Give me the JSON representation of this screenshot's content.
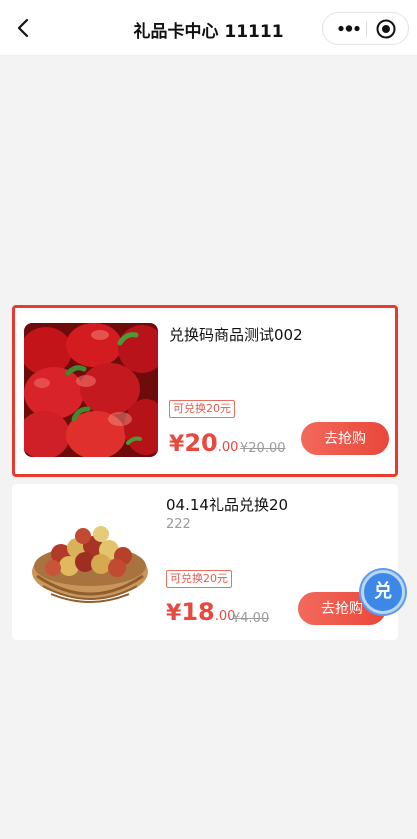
{
  "nav": {
    "title": "礼品卡中心 11111",
    "back_icon": "chevron-left-icon",
    "more_icon": "more-dots-icon",
    "close_icon": "target-circle-icon"
  },
  "products": [
    {
      "name": "兑换码商品测试002",
      "subtitle": "",
      "tag": "可兑换20元",
      "currency": "¥",
      "price_int": "20",
      "price_dec": ".00",
      "original_price": "¥20.00",
      "button_label": "去抢购",
      "image": "red-bell-peppers-image"
    },
    {
      "name": "04.14礼品兑换20",
      "subtitle": "222",
      "tag": "可兑换20元",
      "currency": "¥",
      "price_int": "18",
      "price_dec": ".00",
      "original_price": "¥4.00",
      "button_label": "去抢购",
      "image": "jujube-basket-image"
    }
  ],
  "float_button": {
    "label": "兑"
  },
  "colors": {
    "accent_red": "#e8483f",
    "highlight_border": "#e63b2e",
    "float_blue": "#3d88e6"
  }
}
